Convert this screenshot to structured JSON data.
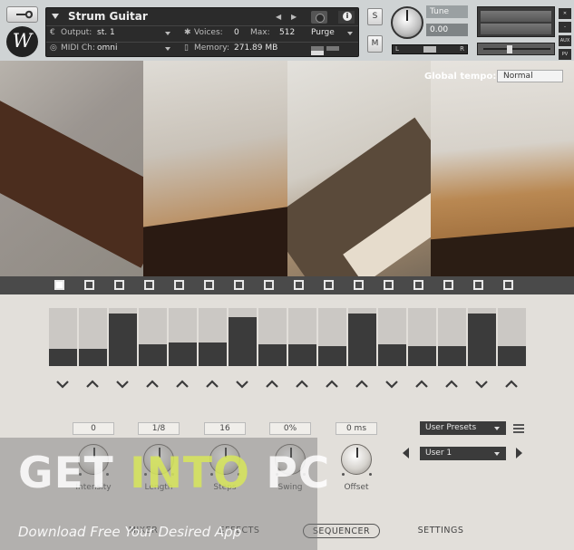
{
  "header": {
    "logo_letter": "W",
    "instrument_name": "Strum Guitar",
    "output_label": "Output:",
    "output_value": "st. 1",
    "voices_label": "Voices:",
    "voices_value": "0",
    "max_label": "Max:",
    "max_value": "512",
    "purge_label": "Purge",
    "midi_label": "MIDI Ch:",
    "midi_value": "omni",
    "memory_label": "Memory:",
    "memory_value": "271.89 MB",
    "s_label": "S",
    "m_label": "M",
    "tune_label": "Tune",
    "tune_value": "0.00",
    "pan_left": "L",
    "pan_right": "R",
    "side_buttons": [
      "AUX",
      "PV"
    ]
  },
  "tempo": {
    "label": "Global tempo:",
    "value": "Normal"
  },
  "steps": {
    "count": 16,
    "active_index": 0
  },
  "sequencer": {
    "bar_levels": [
      0.3,
      0.3,
      0.9,
      0.37,
      0.4,
      0.4,
      0.85,
      0.37,
      0.37,
      0.35,
      0.9,
      0.38,
      0.35,
      0.35,
      0.9,
      0.35
    ],
    "chevron_dirs": [
      "down",
      "up",
      "down",
      "up",
      "up",
      "up",
      "down",
      "up",
      "up",
      "up",
      "up",
      "down",
      "up",
      "up",
      "down",
      "up"
    ],
    "params": [
      {
        "value": "0",
        "label": "Intensity"
      },
      {
        "value": "1/8",
        "label": "Length"
      },
      {
        "value": "16",
        "label": "Steps"
      },
      {
        "value": "0%",
        "label": "Swing"
      },
      {
        "value": "0 ms",
        "label": "Offset"
      }
    ],
    "user_presets_label": "User Presets",
    "preset_value": "User 1"
  },
  "tabs": [
    "MIXER",
    "EFFECTS",
    "SEQUENCER",
    "SETTINGS"
  ],
  "active_tab": "SEQUENCER",
  "watermark": {
    "logo_part1": "GET ",
    "logo_part2": "INTO",
    "logo_part3": " PC",
    "subtitle": "Download Free Your Desired App"
  },
  "colors": {
    "accent": "#3b3b3b",
    "background": "#e2dfda",
    "header": "#cfd3d4"
  }
}
